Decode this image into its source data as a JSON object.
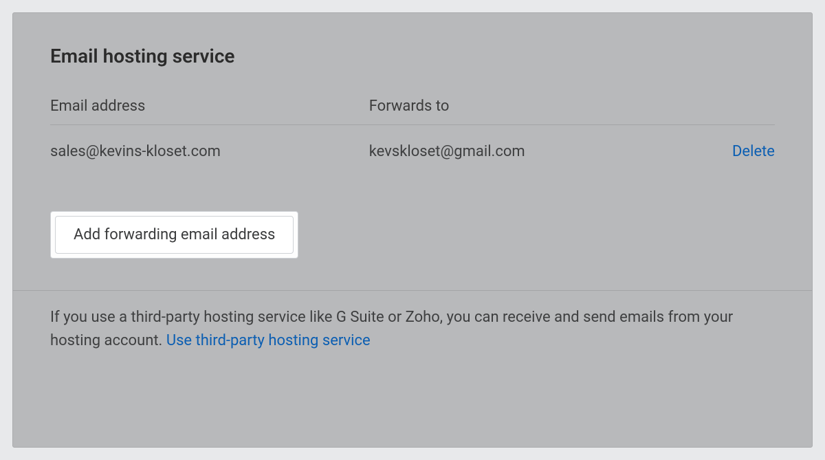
{
  "card": {
    "title": "Email hosting service",
    "columns": {
      "email": "Email address",
      "forwards": "Forwards to"
    },
    "rows": [
      {
        "email": "sales@kevins-kloset.com",
        "forwards": "kevskloset@gmail.com",
        "delete_label": "Delete"
      }
    ],
    "add_button_label": "Add forwarding email address",
    "footer": {
      "text": "If you use a third-party hosting service like G Suite or Zoho, you can receive and send emails from your hosting account. ",
      "link_label": "Use third-party hosting service"
    }
  }
}
